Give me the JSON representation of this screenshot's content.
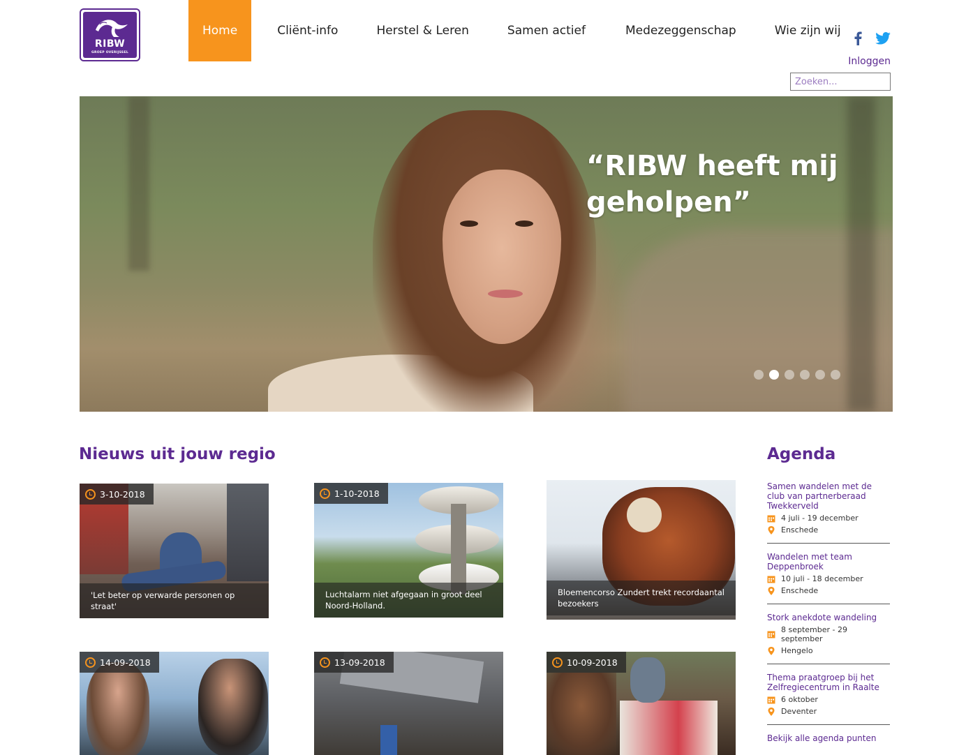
{
  "logo": {
    "name": "RIBW",
    "subtitle": "GROEP OVERIJSSEL"
  },
  "nav": {
    "items": [
      "Home",
      "Cliënt-info",
      "Herstel & Leren",
      "Samen actief",
      "Medezeggenschap",
      "Wie zijn wij"
    ],
    "active": "Home"
  },
  "social": [
    "facebook-icon",
    "twitter-icon"
  ],
  "header": {
    "login_label": "Inloggen",
    "search_placeholder": "Zoeken..."
  },
  "hero": {
    "quote": "“RIBW heeft mij geholpen”",
    "slide_count": 6,
    "active_slide": 2
  },
  "news": {
    "title": "Nieuws uit jouw regio",
    "items": [
      {
        "date": "3-10-2018",
        "caption": "'Let beter op verwarde personen op straat'"
      },
      {
        "date": "1-10-2018",
        "caption": "Luchtalarm niet afgegaan in groot deel Noord-Holland."
      },
      {
        "date": "",
        "caption": "Bloemencorso Zundert trekt recordaantal bezoekers"
      },
      {
        "date": "14-09-2018",
        "caption": ""
      },
      {
        "date": "13-09-2018",
        "caption": ""
      },
      {
        "date": "10-09-2018",
        "caption": ""
      }
    ]
  },
  "agenda": {
    "title": "Agenda",
    "items": [
      {
        "title": "Samen wandelen met de club van partnerberaad Twekkerveld",
        "dates": "4 juli - 19 december",
        "location": "Enschede"
      },
      {
        "title": "Wandelen met team Deppenbroek",
        "dates": "10 juli - 18 december",
        "location": "Enschede"
      },
      {
        "title": "Stork anekdote wandeling",
        "dates": "8 september - 29 september",
        "location": "Hengelo"
      },
      {
        "title": "Thema praatgroep bij het Zelfregiecentrum in Raalte",
        "dates": "6 oktober",
        "location": "Deventer"
      }
    ],
    "more_label": "Bekijk alle agenda punten"
  },
  "colors": {
    "brand_purple": "#5c2a91",
    "accent_orange": "#f7941d"
  }
}
